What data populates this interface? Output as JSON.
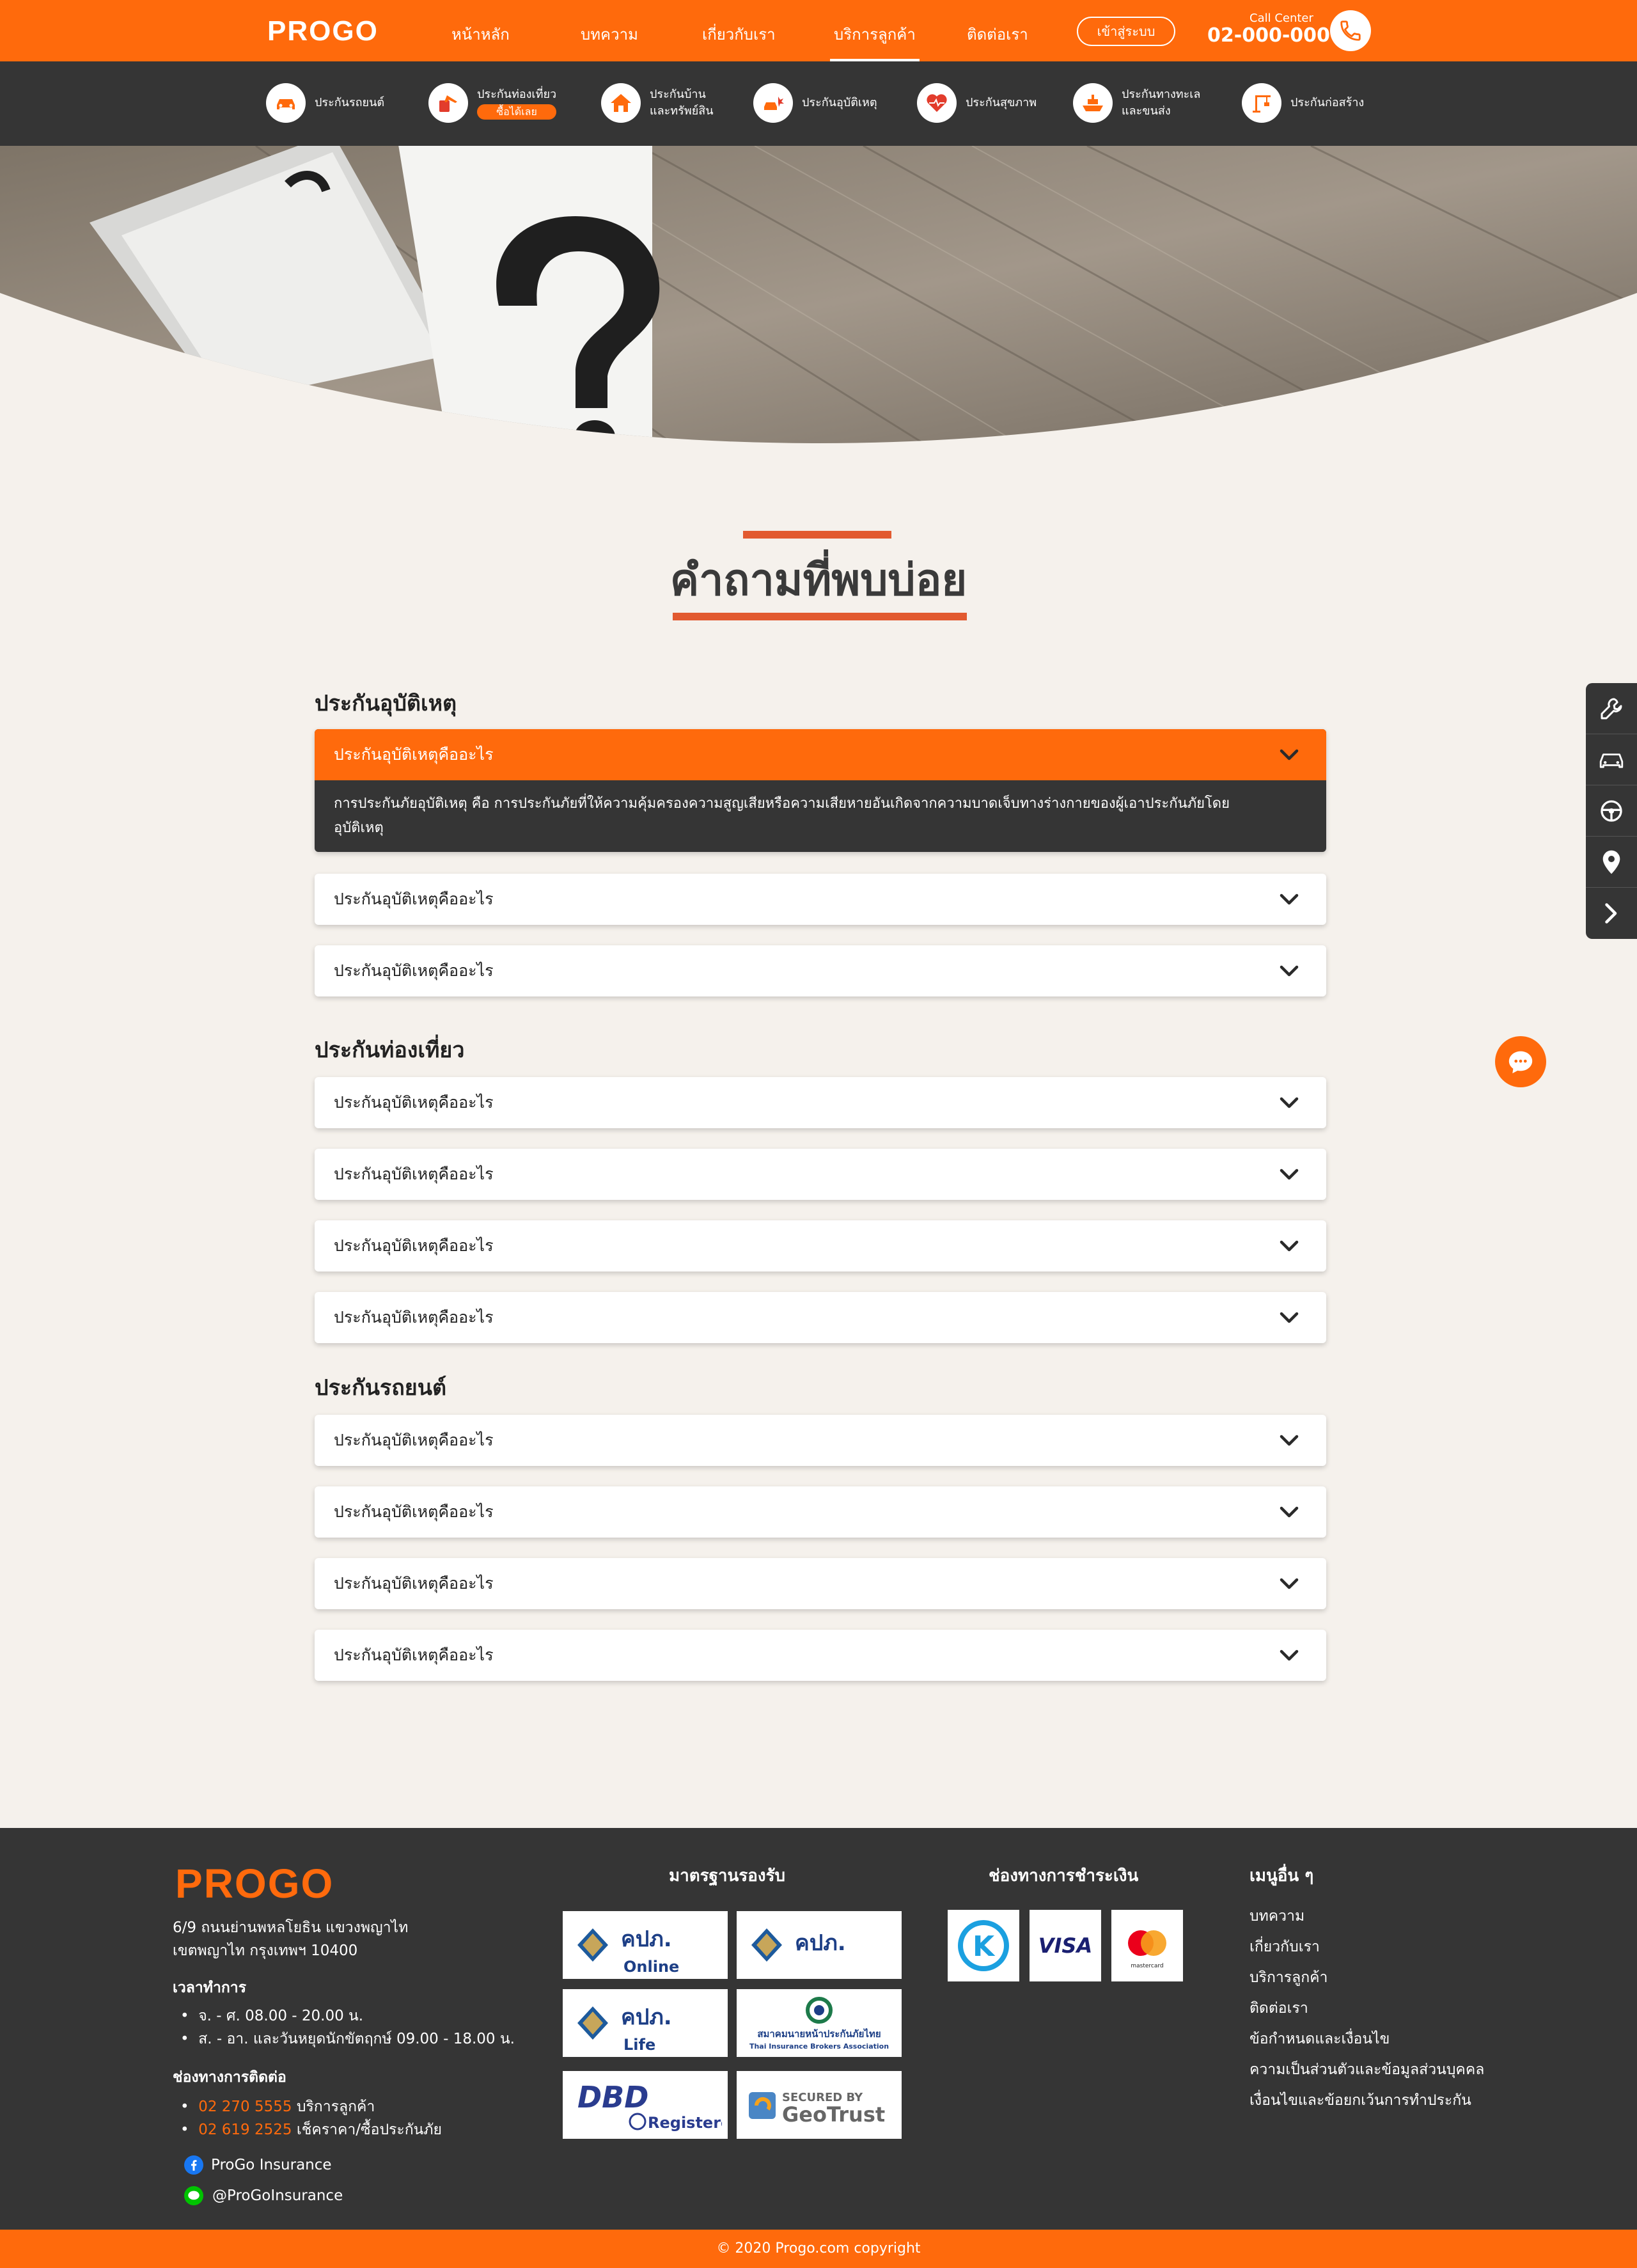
{
  "header": {
    "logo": "PROGO",
    "nav": [
      "หน้าหลัก",
      "บทความ",
      "เกี่ยวกับเรา",
      "บริการลูกค้า",
      "ติดต่อเรา"
    ],
    "active_nav": "บริการลูกค้า",
    "login_label": "เข้าสู่ระบบ",
    "call_center_label": "Call Center",
    "call_center_number": "02-000-000"
  },
  "subnav": {
    "items": [
      {
        "label": "ประกันรถยนต์",
        "icon": "car-icon"
      },
      {
        "label": "ประกันท่องเที่ยว",
        "badge": "ซื้อได้เลย",
        "icon": "travel-icon"
      },
      {
        "label_line1": "ประกันบ้าน",
        "label_line2": "และทรัพย์สิน",
        "icon": "house-icon"
      },
      {
        "label": "ประกันอุบัติเหตุ",
        "icon": "accident-icon"
      },
      {
        "label": "ประกันสุขภาพ",
        "icon": "heart-pulse-icon"
      },
      {
        "label_line1": "ประกันทางทะเล",
        "label_line2": "และขนส่ง",
        "icon": "ship-icon"
      },
      {
        "label": "ประกันก่อสร้าง",
        "icon": "crane-icon"
      }
    ]
  },
  "page": {
    "title": "คำถามที่พบบ่อย"
  },
  "faq": {
    "sections": [
      {
        "heading": "ประกันอุบัติเหตุ",
        "items": [
          {
            "q": "ประกันอุบัติเหตุคืออะไร",
            "open": true,
            "a": "การประกันภัยอุบัติเหตุ คือ การประกันภัยที่ให้ความคุ้มครองความสูญเสียหรือความเสียหายอันเกิดจากความบาดเจ็บทางร่างกายของผู้เอาประกันภัยโดยอุบัติเหตุ"
          },
          {
            "q": "ประกันอุบัติเหตุคืออะไร"
          },
          {
            "q": "ประกันอุบัติเหตุคืออะไร"
          }
        ]
      },
      {
        "heading": "ประกันท่องเที่ยว",
        "items": [
          {
            "q": "ประกันอุบัติเหตุคืออะไร"
          },
          {
            "q": "ประกันอุบัติเหตุคืออะไร"
          },
          {
            "q": "ประกันอุบัติเหตุคืออะไร"
          },
          {
            "q": "ประกันอุบัติเหตุคืออะไร"
          }
        ]
      },
      {
        "heading": "ประกันรถยนต์",
        "items": [
          {
            "q": "ประกันอุบัติเหตุคืออะไร"
          },
          {
            "q": "ประกันอุบัติเหตุคืออะไร"
          },
          {
            "q": "ประกันอุบัติเหตุคืออะไร"
          },
          {
            "q": "ประกันอุบัติเหตุคืออะไร"
          }
        ]
      }
    ]
  },
  "side_panel": {
    "icons": [
      "wrench-icon",
      "car-icon",
      "steering-wheel-icon",
      "location-pin-icon",
      "chevron-right-icon"
    ]
  },
  "chat": {
    "icon": "chat-bubble-icon"
  },
  "footer": {
    "logo": "PROGO",
    "address_line1": "6/9 ถนนย่านพหลโยธิน แขวงพญาไท",
    "address_line2": "เขตพญาไท กรุงเทพฯ 10400",
    "hours_heading": "เวลาทำการ",
    "hours": [
      "จ. - ศ. 08.00 - 20.00 น.",
      "ส. - อา. และวันหยุดนักขัตฤกษ์ 09.00 - 18.00 น."
    ],
    "contact_heading": "ช่องทางการติดต่อ",
    "contacts": [
      {
        "number": "02 270 5555",
        "label": "บริการลูกค้า"
      },
      {
        "number": "02 619 2525",
        "label": "เช็คราคา/ซื้อประกันภัย"
      }
    ],
    "facebook": "ProGo Insurance",
    "line": "@ProGoInsurance",
    "standards_heading": "มาตรฐานรองรับ",
    "certs": [
      {
        "name": "คปภ.",
        "sub": "Online"
      },
      {
        "name": "คปภ.",
        "sub": ""
      },
      {
        "name": "คปภ.",
        "sub": "Life"
      },
      {
        "name": "สมาคมนายหน้าประกันภัยไทย",
        "sub": "Thai Insurance Brokers Association"
      },
      {
        "name": "DBD",
        "sub": "Registered"
      },
      {
        "name": "SECURED BY",
        "sub": "GeoTrust"
      }
    ],
    "payment_heading": "ช่องทางการชำระเงิน",
    "payments": [
      "K",
      "VISA",
      "mastercard"
    ],
    "menu_heading": "เมนูอื่น ๆ",
    "menu": [
      "บทความ",
      "เกี่ยวกับเรา",
      "บริการลูกค้า",
      "ติดต่อเรา",
      "ข้อกำหนดและเงื่อนไข",
      "ความเป็นส่วนตัวและข้อมูลส่วนบุคคล",
      "เงื่อนไขและข้อยกเว้นการทำประกัน"
    ],
    "copyright": "© 2020 Progo.com copyright"
  },
  "colors": {
    "brand": "#ff6a0c",
    "dark": "#353535",
    "accent_bar": "#e25a30",
    "page_bg": "#f5f1ec"
  }
}
